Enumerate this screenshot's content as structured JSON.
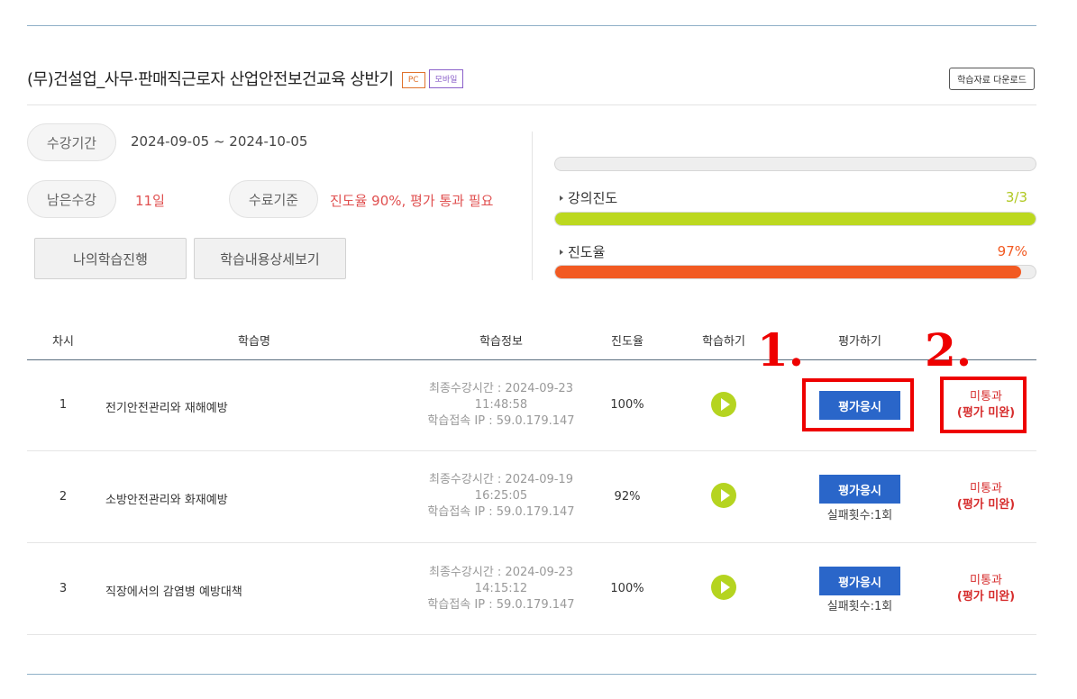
{
  "course": {
    "title": "(무)건설업_사무·판매직근로자 산업안전보건교육 상반기",
    "tag_pc": "PC",
    "tag_mobile": "모바일",
    "download_label": "학습자료 다운로드"
  },
  "info": {
    "period_label": "수강기간",
    "period_value": "2024-09-05 ~ 2024-10-05",
    "remaining_label": "남은수강",
    "remaining_value": "11일",
    "criteria_label": "수료기준",
    "criteria_value": "진도율 90%, 평가 통과 필요",
    "btn_my_progress": "나의학습진행",
    "btn_detail": "학습내용상세보기"
  },
  "progress": {
    "lecture_label": "강의진도",
    "lecture_value": "3/3",
    "lecture_fraction": 1.0,
    "rate_label": "진도율",
    "rate_value": "97%",
    "rate_fraction": 0.97,
    "lecture_color": "#bcd81f",
    "rate_color": "#f25a22"
  },
  "table": {
    "headers": [
      "차시",
      "학습명",
      "학습정보",
      "진도율",
      "학습하기",
      "평가하기"
    ],
    "rows": [
      {
        "no": "1",
        "name": "전기안전관리와 재해예방",
        "info_line1": "최종수강시간 : 2024-09-23",
        "info_line2": "11:48:58",
        "info_line3": "학습접속 IP : 59.0.179.147",
        "rate": "100%",
        "eval_label": "평가응시",
        "fail_count": "",
        "status_line1": "미통과",
        "status_line2": "(평가 미완)"
      },
      {
        "no": "2",
        "name": "소방안전관리와 화재예방",
        "info_line1": "최종수강시간 : 2024-09-19",
        "info_line2": "16:25:05",
        "info_line3": "학습접속 IP : 59.0.179.147",
        "rate": "92%",
        "eval_label": "평가응시",
        "fail_count": "실패횟수:1회",
        "status_line1": "미통과",
        "status_line2": "(평가 미완)"
      },
      {
        "no": "3",
        "name": "직장에서의 감염병 예방대책",
        "info_line1": "최종수강시간 : 2024-09-23",
        "info_line2": "14:15:12",
        "info_line3": "학습접속 IP : 59.0.179.147",
        "rate": "100%",
        "eval_label": "평가응시",
        "fail_count": "실패횟수:1회",
        "status_line1": "미통과",
        "status_line2": "(평가 미완)"
      }
    ]
  },
  "annotations": {
    "marker1": "1.",
    "marker2": "2."
  },
  "colors": {
    "accent_blue": "#2a66c9",
    "status_red": "#d62c2c",
    "annotation_red": "#ee0000",
    "play_green": "#b5d420"
  }
}
